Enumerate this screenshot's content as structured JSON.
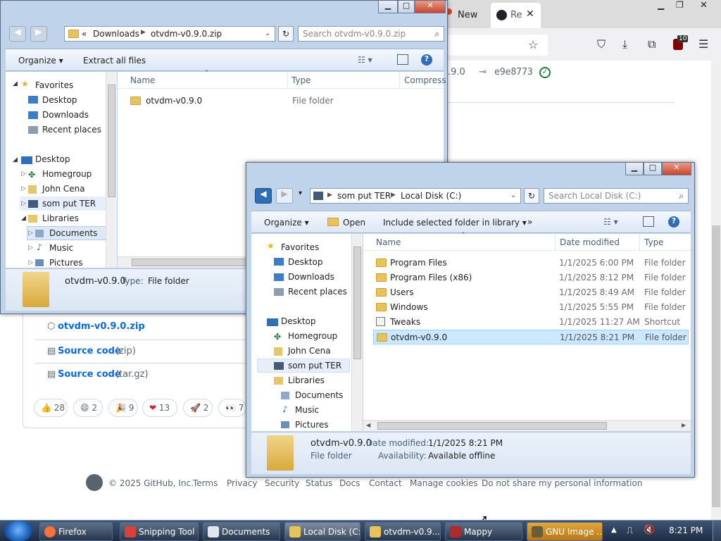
{
  "browser": {
    "tab_partial": "New",
    "active_tab_label": "Re",
    "tab_close": "✕",
    "extension_badge": "10",
    "version_partial": ".9.0",
    "commit_hash": "e9e8773",
    "assets": [
      {
        "name": "otvdm-v0.9.0.zip",
        "suffix": ""
      },
      {
        "name": "Source code",
        "suffix": "(zip)"
      },
      {
        "name": "Source code",
        "suffix": "(tar.gz)"
      }
    ],
    "reactions": [
      {
        "emoji": "👍",
        "count": "28"
      },
      {
        "emoji": "😄",
        "count": "2"
      },
      {
        "emoji": "🎉",
        "count": "9"
      },
      {
        "emoji": "❤",
        "count": "13"
      },
      {
        "emoji": "🚀",
        "count": "2"
      },
      {
        "emoji": "👀",
        "count": "7"
      }
    ],
    "footer": {
      "copyright": "© 2025 GitHub, Inc.",
      "links": [
        "Terms",
        "Privacy",
        "Security",
        "Status",
        "Docs",
        "Contact",
        "Manage cookies",
        "Do not share my personal information"
      ]
    }
  },
  "zip_window": {
    "breadcrumb_prefix": "«",
    "breadcrumb": [
      "Downloads",
      "otvdm-v0.9.0.zip"
    ],
    "search_placeholder": "Search otvdm-v0.9.0.zip",
    "toolbar": {
      "organize": "Organize",
      "extract": "Extract all files"
    },
    "columns": [
      "Name",
      "Type",
      "Compress"
    ],
    "nav": {
      "favorites": "Favorites",
      "fav_items": [
        "Desktop",
        "Downloads",
        "Recent places"
      ],
      "desktop": "Desktop",
      "desktop_items": [
        "Homegroup",
        "John Cena",
        "som put TER",
        "Libraries"
      ],
      "library_items": [
        "Documents",
        "Music",
        "Pictures"
      ]
    },
    "files": [
      {
        "name": "otvdm-v0.9.0",
        "type": "File folder"
      }
    ],
    "details": {
      "name": "otvdm-v0.9.0",
      "type_label": "Type:",
      "type_value": "File folder"
    }
  },
  "disk_window": {
    "breadcrumb": [
      "som put TER",
      "Local Disk (C:)"
    ],
    "search_placeholder": "Search Local Disk (C:)",
    "toolbar": {
      "organize": "Organize",
      "open": "Open",
      "include": "Include selected folder in library",
      "more": "»"
    },
    "columns": [
      "Name",
      "Date modified",
      "Type"
    ],
    "nav": {
      "favorites": "Favorites",
      "fav_items": [
        "Desktop",
        "Downloads",
        "Recent places"
      ],
      "desktop": "Desktop",
      "desktop_items": [
        "Homegroup",
        "John Cena",
        "som put TER",
        "Libraries"
      ],
      "library_items": [
        "Documents",
        "Music",
        "Pictures"
      ]
    },
    "files": [
      {
        "name": "Program Files",
        "date": "1/1/2025 6:00 PM",
        "type": "File folder"
      },
      {
        "name": "Program Files (x86)",
        "date": "1/1/2025 8:12 PM",
        "type": "File folder"
      },
      {
        "name": "Users",
        "date": "1/1/2025 8:49 AM",
        "type": "File folder"
      },
      {
        "name": "Windows",
        "date": "1/1/2025 5:55 PM",
        "type": "File folder"
      },
      {
        "name": "Tweaks",
        "date": "1/1/2025 11:27 AM",
        "type": "Shortcut"
      },
      {
        "name": "otvdm-v0.9.0",
        "date": "1/1/2025 8:21 PM",
        "type": "File folder"
      }
    ],
    "details": {
      "name": "otvdm-v0.9.0",
      "date_label": "Date modified:",
      "date_value": "1/1/2025 8:21 PM",
      "kind": "File folder",
      "avail_label": "Availability:",
      "avail_value": "Available offline"
    }
  },
  "taskbar": {
    "items": [
      "Firefox",
      "Snipping Tool",
      "Documents",
      "Local Disk (C:)",
      "otvdm-v0.9....",
      "Mappy",
      "GNU Image ..."
    ],
    "clock": "8:21 PM"
  },
  "colors": {
    "selection": "#cce8ff",
    "link": "#0969da",
    "taskbar": "#1c2c44"
  }
}
